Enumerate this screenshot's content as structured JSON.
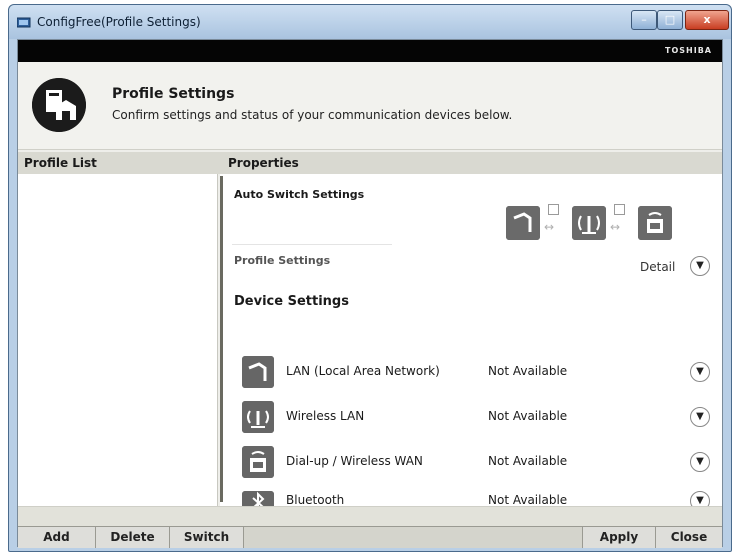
{
  "window": {
    "title": "ConfigFree(Profile Settings)",
    "brand": "TOSHIBA",
    "controls": {
      "minimize": "–",
      "maximize": "□",
      "close": "x"
    }
  },
  "header": {
    "title": "Profile Settings",
    "subtitle": "Confirm settings and status of your communication devices below."
  },
  "columns": {
    "profile_list": "Profile List",
    "properties": "Properties"
  },
  "properties": {
    "auto_switch_title": "Auto Switch Settings",
    "profile_settings": "Profile Settings",
    "detail_label": "Detail",
    "device_settings": "Device Settings",
    "devices": [
      {
        "name": "LAN (Local Area Network)",
        "status": "Not Available",
        "icon": "lan-icon"
      },
      {
        "name": "Wireless LAN",
        "status": "Not Available",
        "icon": "wireless-lan-icon"
      },
      {
        "name": "Dial-up / Wireless WAN",
        "status": "Not Available",
        "icon": "dialup-icon"
      },
      {
        "name": "Bluetooth",
        "status": "Not Available",
        "icon": "bluetooth-icon"
      }
    ]
  },
  "buttons": {
    "add": "Add",
    "delete": "Delete",
    "switch": "Switch",
    "apply": "Apply",
    "close": "Close"
  }
}
